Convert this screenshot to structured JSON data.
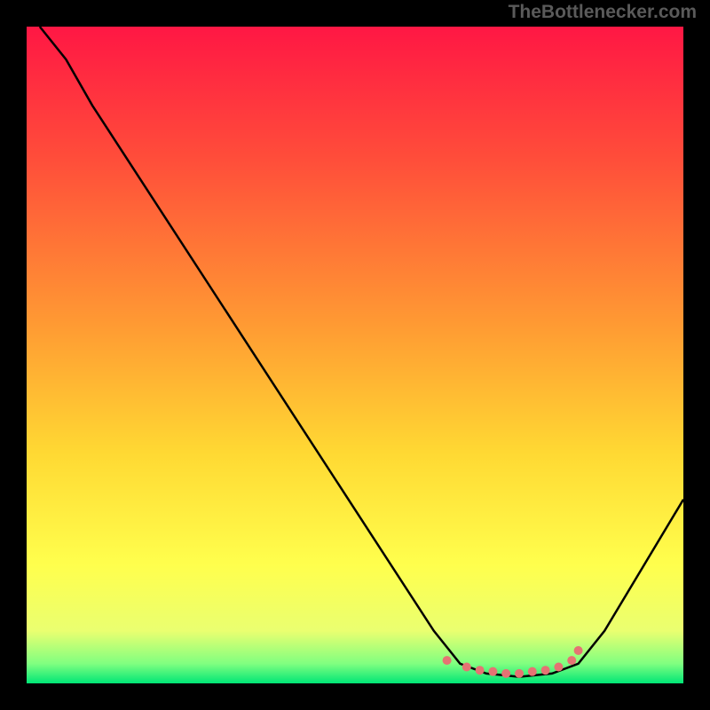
{
  "watermark": "TheBottlenecker.com",
  "chart_data": {
    "type": "line",
    "title": "",
    "xlabel": "",
    "ylabel": "",
    "x_range": [
      0,
      100
    ],
    "y_range": [
      0,
      100
    ],
    "gradient_stops": [
      {
        "offset": 0,
        "color": "#ff1744"
      },
      {
        "offset": 20,
        "color": "#ff4d3a"
      },
      {
        "offset": 45,
        "color": "#ff9933"
      },
      {
        "offset": 65,
        "color": "#ffd933"
      },
      {
        "offset": 82,
        "color": "#ffff4d"
      },
      {
        "offset": 92,
        "color": "#eaff70"
      },
      {
        "offset": 97,
        "color": "#80ff80"
      },
      {
        "offset": 100,
        "color": "#00e676"
      }
    ],
    "curve_points": [
      {
        "x": 2,
        "y": 100
      },
      {
        "x": 6,
        "y": 95
      },
      {
        "x": 10,
        "y": 88
      },
      {
        "x": 62,
        "y": 8
      },
      {
        "x": 66,
        "y": 3
      },
      {
        "x": 70,
        "y": 1.5
      },
      {
        "x": 75,
        "y": 1
      },
      {
        "x": 80,
        "y": 1.5
      },
      {
        "x": 84,
        "y": 3
      },
      {
        "x": 88,
        "y": 8
      },
      {
        "x": 100,
        "y": 28
      }
    ],
    "scatter_points": [
      {
        "x": 64,
        "y": 3.5
      },
      {
        "x": 67,
        "y": 2.5
      },
      {
        "x": 69,
        "y": 2
      },
      {
        "x": 71,
        "y": 1.8
      },
      {
        "x": 73,
        "y": 1.5
      },
      {
        "x": 75,
        "y": 1.5
      },
      {
        "x": 77,
        "y": 1.8
      },
      {
        "x": 79,
        "y": 2
      },
      {
        "x": 81,
        "y": 2.5
      },
      {
        "x": 83,
        "y": 3.5
      },
      {
        "x": 84,
        "y": 5
      }
    ],
    "scatter_color": "#e57373",
    "curve_color": "#000000"
  }
}
